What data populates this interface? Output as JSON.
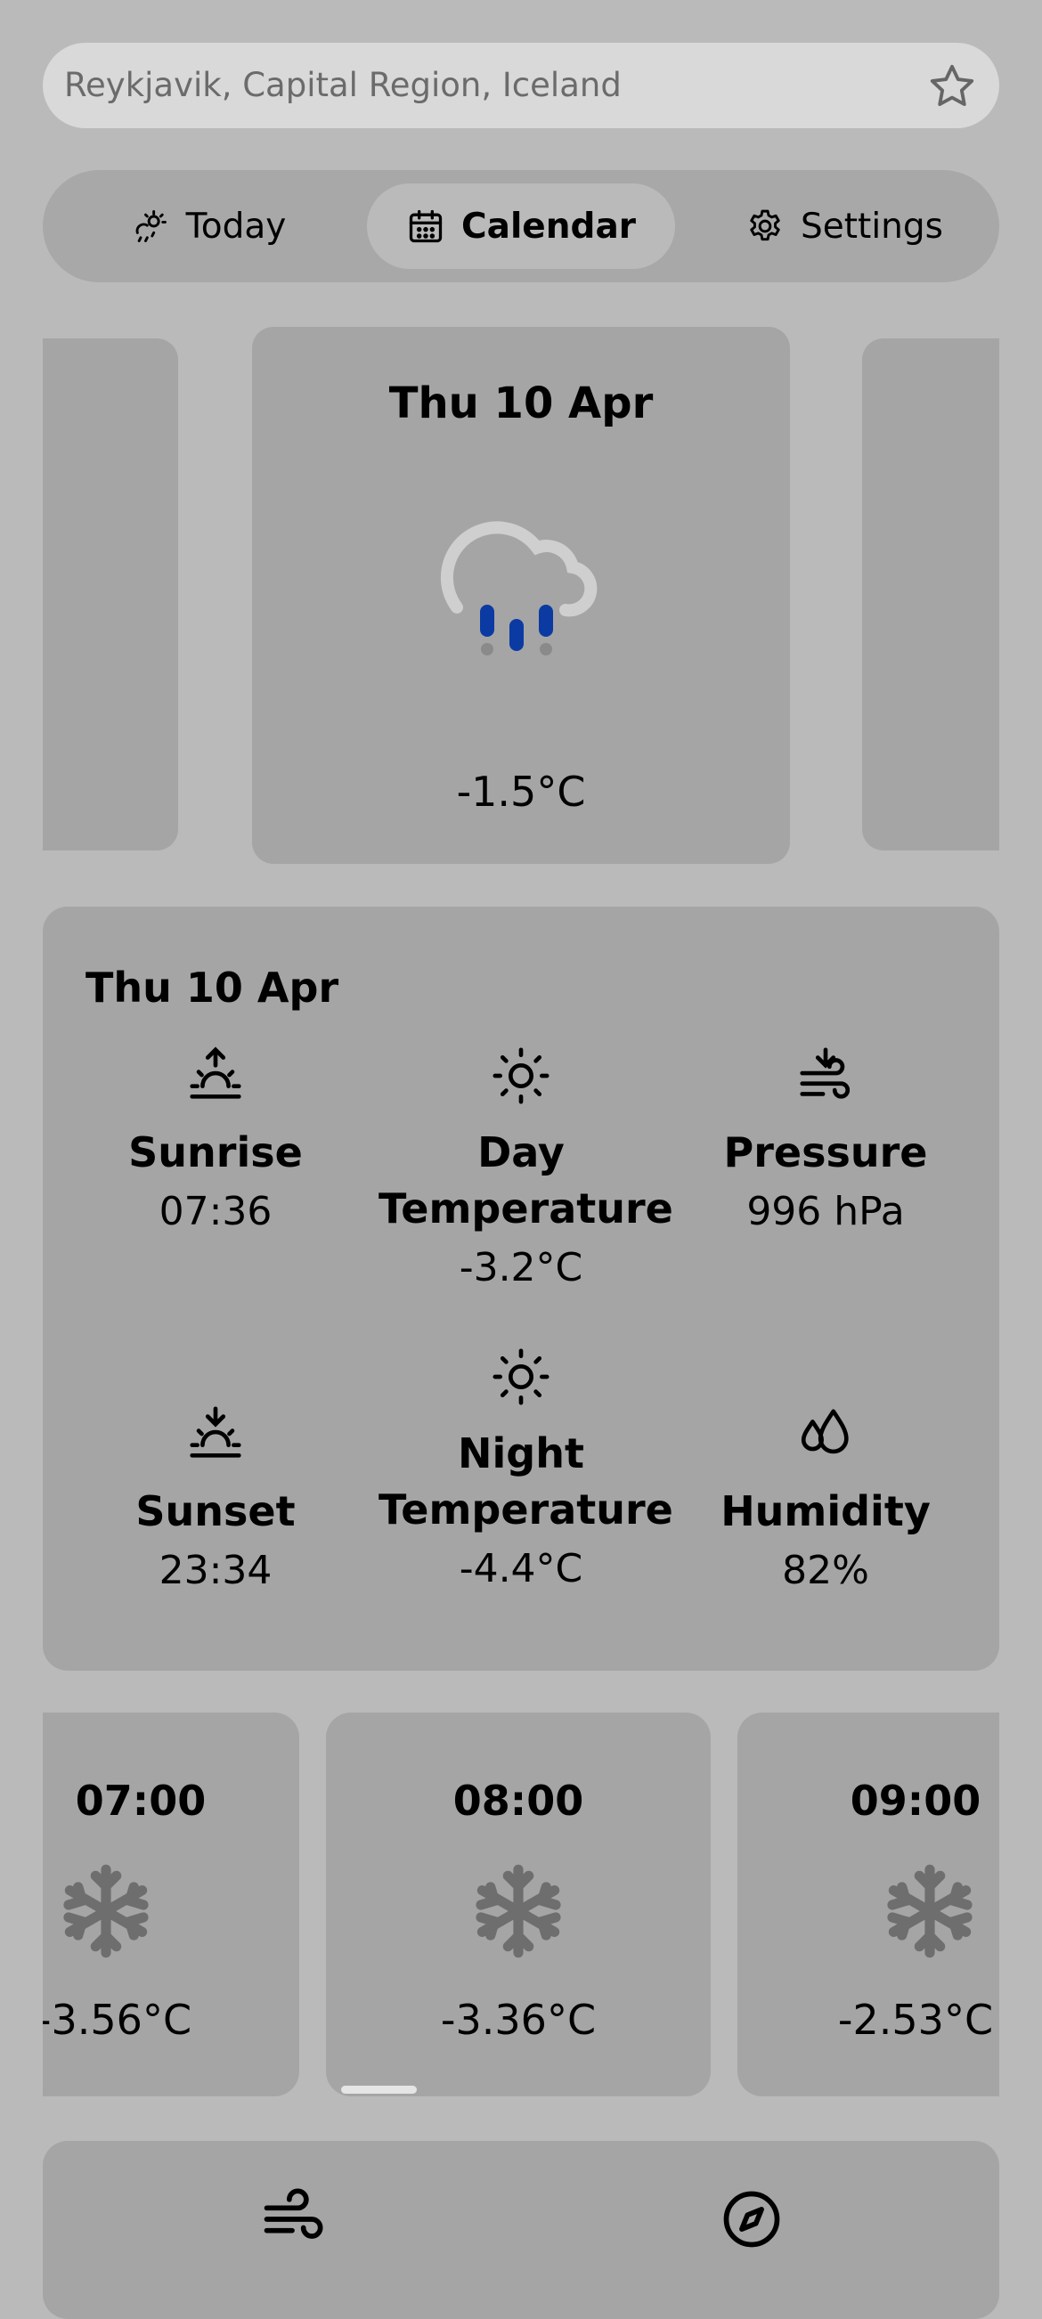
{
  "search": {
    "location": "Reykjavik, Capital Region, Iceland",
    "favorite_icon": "star-outline-icon"
  },
  "tabs": [
    {
      "label": "Today",
      "icon": "sun-cloud-rain-icon",
      "active": false
    },
    {
      "label": "Calendar",
      "icon": "calendar-icon",
      "active": true
    },
    {
      "label": "Settings",
      "icon": "gear-icon",
      "active": false
    }
  ],
  "day_card": {
    "date": "Thu 10 Apr",
    "icon": "cloud-sleet-icon",
    "temperature": "-1.5°C"
  },
  "details": {
    "date": "Thu 10 Apr",
    "items": [
      {
        "label": "Sunrise",
        "value": "07:36",
        "icon": "sunrise-icon"
      },
      {
        "label": "Day Temperature",
        "value": "-3.2°C",
        "icon": "sun-icon"
      },
      {
        "label": "Pressure",
        "value": "996 hPa",
        "icon": "pressure-wind-icon"
      },
      {
        "label": "Sunset",
        "value": "23:34",
        "icon": "sunset-icon"
      },
      {
        "label": "Night Temperature",
        "value": "-4.4°C",
        "icon": "sun-icon"
      },
      {
        "label": "Humidity",
        "value": "82%",
        "icon": "humidity-drops-icon"
      }
    ]
  },
  "hourly": [
    {
      "time": "07:00",
      "icon": "snowflake-icon",
      "temperature": "-3.56°C"
    },
    {
      "time": "08:00",
      "icon": "snowflake-icon",
      "temperature": "-3.36°C"
    },
    {
      "time": "09:00",
      "icon": "snowflake-icon",
      "temperature": "-2.53°C"
    }
  ],
  "bottom_card": {
    "icons": [
      "wind-icon",
      "compass-icon"
    ]
  },
  "colors": {
    "background": "#bababa",
    "card": "#a5a5a5",
    "search": "#d9d9d9",
    "rain_drops": "#0b3aa3",
    "snowflake": "#6e6e6e"
  }
}
